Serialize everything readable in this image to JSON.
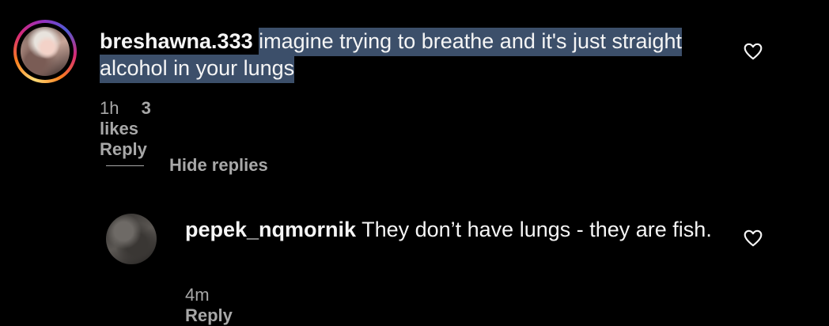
{
  "comment": {
    "username": "breshawna.333",
    "text": "imagine trying to breathe and it's just straight alcohol in your lungs",
    "time": "1h",
    "likes": "3 likes",
    "reply_label": "Reply"
  },
  "hide_replies_label": "Hide replies",
  "reply": {
    "username": "pepek_nqmornik",
    "text": "They don’t have lungs - they are fish.",
    "time": "4m",
    "reply_label": "Reply"
  },
  "colors": {
    "background": "#000000",
    "text": "#f5f5f5",
    "secondary_text": "#a8a8a8",
    "selection": "#3c4f6a"
  }
}
